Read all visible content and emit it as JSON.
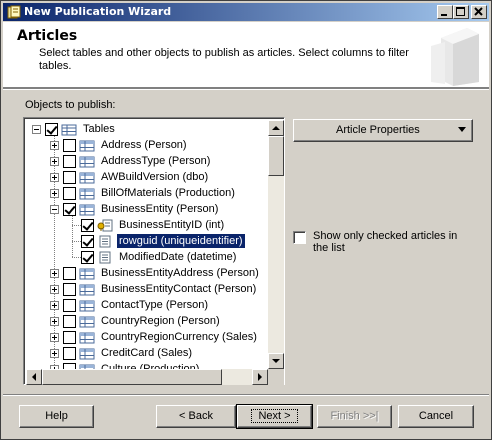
{
  "window": {
    "title": "New Publication Wizard"
  },
  "header": {
    "title": "Articles",
    "subtitle": "Select tables and other objects to publish as articles. Select columns to filter tables."
  },
  "objects_label": "Objects to publish:",
  "tree": {
    "rows": [
      {
        "label": "Tables",
        "checked": true,
        "expander": "minus",
        "icon": "tables-folder-icon",
        "depth": 0
      },
      {
        "label": "Address (Person)",
        "checked": false,
        "expander": "plus",
        "icon": "table-icon",
        "depth": 1
      },
      {
        "label": "AddressType (Person)",
        "checked": false,
        "expander": "plus",
        "icon": "table-icon",
        "depth": 1
      },
      {
        "label": "AWBuildVersion (dbo)",
        "checked": false,
        "expander": "plus",
        "icon": "table-icon",
        "depth": 1
      },
      {
        "label": "BillOfMaterials (Production)",
        "checked": false,
        "expander": "plus",
        "icon": "table-icon",
        "depth": 1
      },
      {
        "label": "BusinessEntity (Person)",
        "checked": true,
        "expander": "minus",
        "icon": "table-icon",
        "depth": 1
      },
      {
        "label": "BusinessEntityID (int)",
        "checked": true,
        "expander": "none",
        "icon": "primary-key-column-icon",
        "depth": 2
      },
      {
        "label": "rowguid (uniqueidentifier)",
        "checked": true,
        "expander": "none",
        "icon": "column-icon",
        "depth": 2,
        "selected": true
      },
      {
        "label": "ModifiedDate (datetime)",
        "checked": true,
        "expander": "none",
        "icon": "column-icon",
        "depth": 2
      },
      {
        "label": "BusinessEntityAddress (Person)",
        "checked": false,
        "expander": "plus",
        "icon": "table-icon",
        "depth": 1
      },
      {
        "label": "BusinessEntityContact (Person)",
        "checked": false,
        "expander": "plus",
        "icon": "table-icon",
        "depth": 1
      },
      {
        "label": "ContactType (Person)",
        "checked": false,
        "expander": "plus",
        "icon": "table-icon",
        "depth": 1
      },
      {
        "label": "CountryRegion (Person)",
        "checked": false,
        "expander": "plus",
        "icon": "table-icon",
        "depth": 1
      },
      {
        "label": "CountryRegionCurrency (Sales)",
        "checked": false,
        "expander": "plus",
        "icon": "table-icon",
        "depth": 1
      },
      {
        "label": "CreditCard (Sales)",
        "checked": false,
        "expander": "plus",
        "icon": "table-icon",
        "depth": 1
      },
      {
        "label": "Culture (Production)",
        "checked": false,
        "expander": "plus",
        "icon": "table-icon",
        "depth": 1
      }
    ]
  },
  "article_properties_button": "Article Properties",
  "show_only_checked": {
    "label": "Show only checked articles in the list",
    "checked": false
  },
  "footer": {
    "help": "Help",
    "back": "< Back",
    "next": "Next >",
    "finish": "Finish >>|",
    "cancel": "Cancel"
  },
  "colors": {
    "titlebar_start": "#0a246a",
    "titlebar_end": "#a6caf0",
    "selection": "#0a246a",
    "face": "#d4d0c8"
  }
}
